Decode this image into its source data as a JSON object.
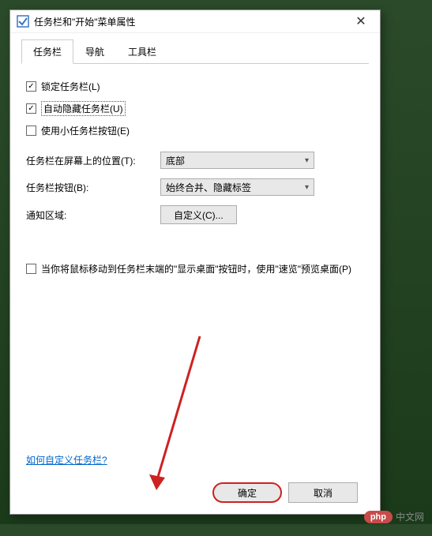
{
  "window": {
    "title": "任务栏和\"开始\"菜单属性"
  },
  "tabs": {
    "taskbar": "任务栏",
    "navigation": "导航",
    "toolbars": "工具栏"
  },
  "checkboxes": {
    "lock": "锁定任务栏(L)",
    "autohide": "自动隐藏任务栏(U)",
    "smallbuttons": "使用小任务栏按钮(E)",
    "peek": "当你将鼠标移动到任务栏末端的\"显示桌面\"按钮时，使用\"速览\"预览桌面(P)"
  },
  "labels": {
    "position": "任务栏在屏幕上的位置(T):",
    "buttons": "任务栏按钮(B):",
    "notify_area": "通知区域:"
  },
  "selects": {
    "position_value": "底部",
    "buttons_value": "始终合并、隐藏标签"
  },
  "buttons": {
    "customize": "自定义(C)...",
    "ok": "确定",
    "cancel": "取消"
  },
  "link": {
    "help": "如何自定义任务栏?"
  },
  "watermark": {
    "badge": "php",
    "text": "中文网"
  }
}
